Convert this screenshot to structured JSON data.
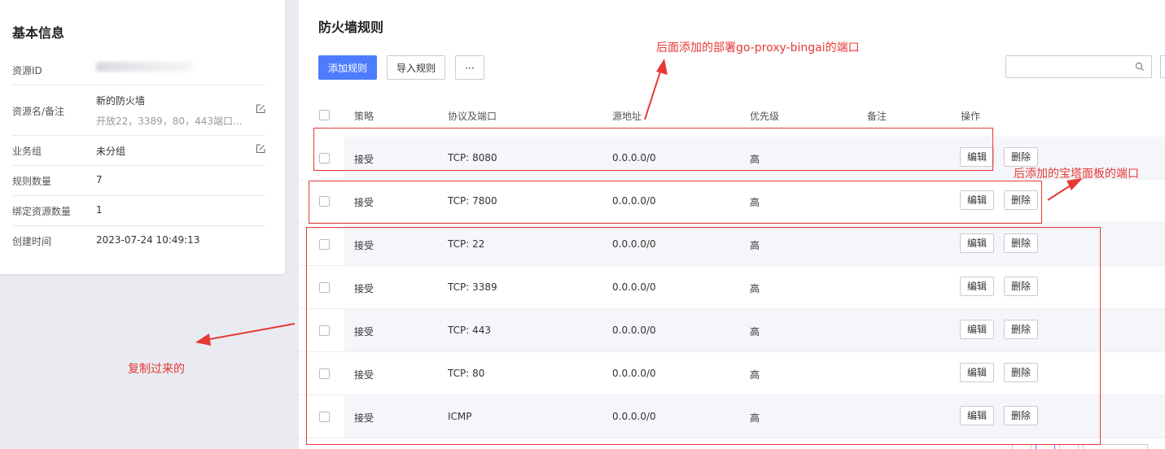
{
  "info": {
    "title": "基本信息",
    "rows": [
      {
        "key": "资源ID",
        "value": ""
      },
      {
        "key": "资源名/备注",
        "value": "新的防火墙",
        "sub": "开放22，3389，80，443端口..."
      },
      {
        "key": "业务组",
        "value": "未分组"
      },
      {
        "key": "规则数量",
        "value": "7"
      },
      {
        "key": "绑定资源数量",
        "value": "1"
      },
      {
        "key": "创建时间",
        "value": "2023-07-24 10:49:13"
      }
    ]
  },
  "firewall": {
    "title": "防火墙规则",
    "add_label": "添加规则",
    "import_label": "导入规则",
    "more_label": "···",
    "search_placeholder": "",
    "columns": [
      "策略",
      "协议及端口",
      "源地址",
      "优先级",
      "备注",
      "操作"
    ],
    "edit_label": "编辑",
    "delete_label": "删除",
    "rules": [
      {
        "policy": "接受",
        "port": "TCP: 8080",
        "source": "0.0.0.0/0",
        "priority": "高",
        "note": ""
      },
      {
        "policy": "接受",
        "port": "TCP: 7800",
        "source": "0.0.0.0/0",
        "priority": "高",
        "note": ""
      },
      {
        "policy": "接受",
        "port": "TCP: 22",
        "source": "0.0.0.0/0",
        "priority": "高",
        "note": ""
      },
      {
        "policy": "接受",
        "port": "TCP: 3389",
        "source": "0.0.0.0/0",
        "priority": "高",
        "note": ""
      },
      {
        "policy": "接受",
        "port": "TCP: 443",
        "source": "0.0.0.0/0",
        "priority": "高",
        "note": ""
      },
      {
        "policy": "接受",
        "port": "TCP: 80",
        "source": "0.0.0.0/0",
        "priority": "高",
        "note": ""
      },
      {
        "policy": "接受",
        "port": "ICMP",
        "source": "0.0.0.0/0",
        "priority": "高",
        "note": ""
      }
    ]
  },
  "annotations": {
    "top": "后面添加的部署go-proxy-bingai的端口",
    "right": "后添加的宝塔面板的端口",
    "left": "复制过来的",
    "color": "#e53935"
  }
}
